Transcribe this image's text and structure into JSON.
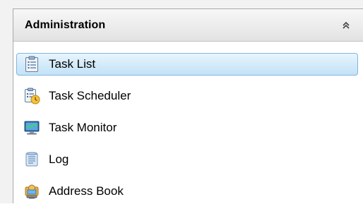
{
  "panel": {
    "title": "Administration",
    "collapse_icon": "double-chevron-up-icon"
  },
  "items": [
    {
      "label": "Task List",
      "icon": "task-list-icon",
      "selected": true
    },
    {
      "label": "Task Scheduler",
      "icon": "task-scheduler-icon",
      "selected": false
    },
    {
      "label": "Task Monitor",
      "icon": "task-monitor-icon",
      "selected": false
    },
    {
      "label": "Log",
      "icon": "log-icon",
      "selected": false
    },
    {
      "label": "Address Book",
      "icon": "address-book-icon",
      "selected": false
    }
  ],
  "colors": {
    "selection_border": "#7fb6e0",
    "selection_fill": "#d4ebfa"
  }
}
